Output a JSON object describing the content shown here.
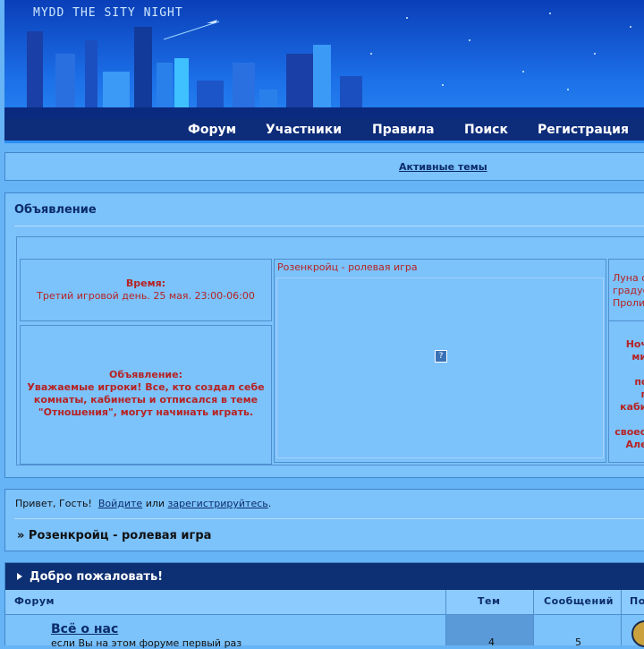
{
  "header": {
    "logo_text": "MYDD THE  SITY NIGHT",
    "nav": [
      "Форум",
      "Участники",
      "Правила",
      "Поиск",
      "Регистрация"
    ]
  },
  "active_topics": "Активные темы",
  "announcement": {
    "title": "Объявление",
    "time_label": "Время:",
    "time_value": "Третий игровой день. 25 мая. 23:00-06:00",
    "notice_title": "Объявление:",
    "notice_text": "Уважаемые игроки! Все, кто создал себе комнаты, кабинеты и отписался в теме \"Отношения\", могут начинать играть.",
    "center_caption": "Розенкройц - ролевая игра",
    "right_top_lines": [
      "Луна с",
      "градус",
      "Проли"
    ],
    "right_bottom_lines": [
      "Ночь",
      "мир",
      "",
      "пос",
      "пь",
      "кабин",
      "О",
      "своеоб",
      "Алек",
      "("
    ]
  },
  "greeting": {
    "prefix": "Привет, Гость!",
    "login": "Войдите",
    "or": "или",
    "register": "зарегистрируйтесь",
    "suffix": ".",
    "breadcrumb": "» Розенкройц - ролевая игра"
  },
  "forum": {
    "heading": "Добро пожаловать!",
    "columns": [
      "Форум",
      "Тем",
      "Сообщений",
      "По"
    ],
    "rows": [
      {
        "name": "Всё о нас",
        "desc": "если Вы на этом форуме первый раз",
        "topics": "4",
        "posts": "5"
      }
    ]
  },
  "colors": {
    "page_bg": "#66b3f5",
    "header_nav": "#0d2c7a",
    "text_red": "#b62323",
    "link": "#0b2c6b"
  }
}
